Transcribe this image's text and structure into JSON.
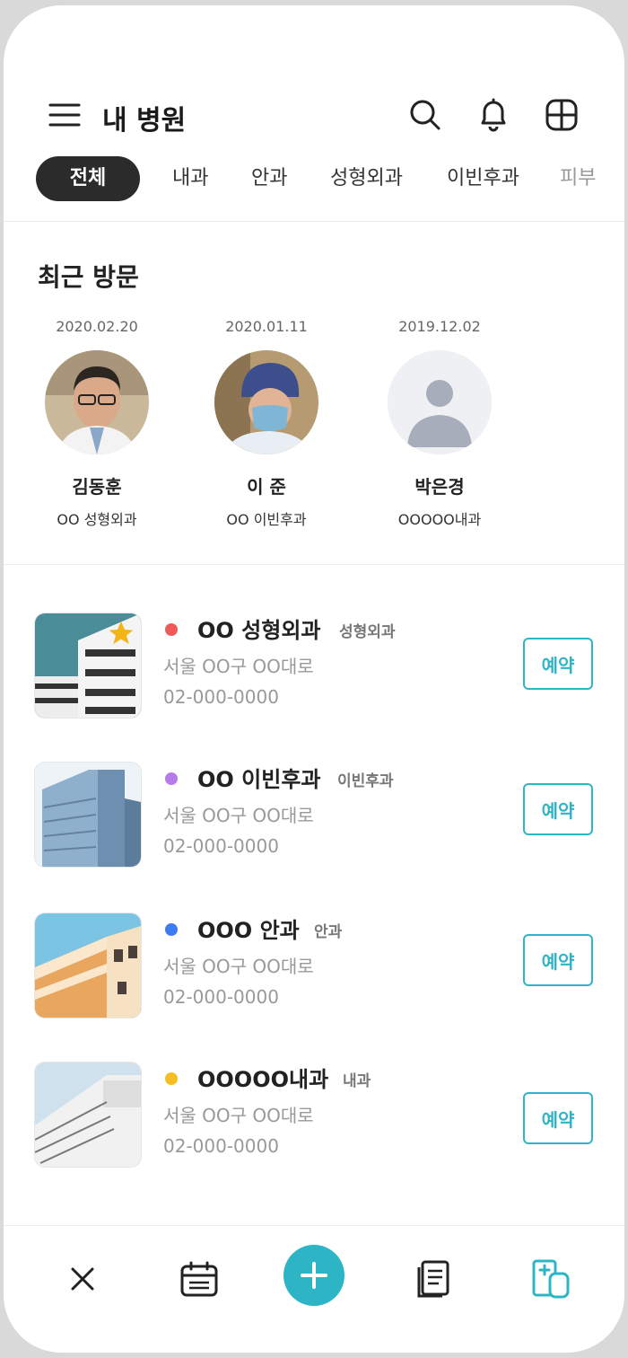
{
  "header": {
    "title": "내 병원"
  },
  "tabs": [
    "전체",
    "내과",
    "안과",
    "성형외과",
    "이빈후과",
    "피부"
  ],
  "recent": {
    "title": "최근 방문",
    "items": [
      {
        "date": "2020.02.20",
        "name": "김동훈",
        "dept": "OO 성형외과",
        "avatar": "doctor-glasses-photo"
      },
      {
        "date": "2020.01.11",
        "name": "이 준",
        "dept": "OO 이빈후과",
        "avatar": "doctor-surgical-cap-photo"
      },
      {
        "date": "2019.12.02",
        "name": "박은경",
        "dept": "OOOOO내과",
        "avatar": "default-person-icon"
      }
    ]
  },
  "hospitals": [
    {
      "name": "OO 성형외과",
      "tag": "성형외과",
      "address": "서울 OO구 OO대로",
      "phone": "02-000-0000",
      "dot_color": "#ee5a5a",
      "reserve": "예약",
      "favorite": true
    },
    {
      "name": "OO 이빈후과",
      "tag": "이빈후과",
      "address": "서울 OO구 OO대로",
      "phone": "02-000-0000",
      "dot_color": "#b57be8",
      "reserve": "예약",
      "favorite": false
    },
    {
      "name": "OOO 안과",
      "tag": "안과",
      "address": "서울 OO구 OO대로",
      "phone": "02-000-0000",
      "dot_color": "#3d7cf0",
      "reserve": "예약",
      "favorite": false
    },
    {
      "name": "OOOOO내과",
      "tag": "내과",
      "address": "서울 OO구 OO대로",
      "phone": "02-000-0000",
      "dot_color": "#f5be24",
      "reserve": "예약",
      "favorite": false
    }
  ],
  "bottom_nav": [
    "close-icon",
    "calendar-icon",
    "add-icon",
    "document-icon",
    "hospital-add-icon"
  ],
  "colors": {
    "accent": "#2db5c6",
    "active_tab": "#2b2b2b"
  }
}
